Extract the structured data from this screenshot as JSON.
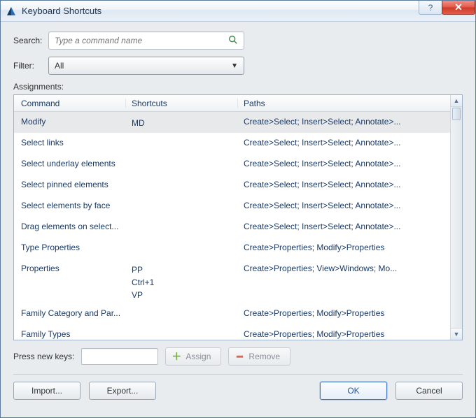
{
  "window": {
    "title": "Keyboard Shortcuts"
  },
  "labels": {
    "search": "Search:",
    "filter": "Filter:",
    "assignments": "Assignments:",
    "press_new_keys": "Press new keys:"
  },
  "search": {
    "placeholder": "Type a command name"
  },
  "filter": {
    "value": "All"
  },
  "columns": {
    "command": "Command",
    "shortcuts": "Shortcuts",
    "paths": "Paths"
  },
  "rows": [
    {
      "command": "Modify",
      "shortcuts": [
        "MD"
      ],
      "path": "Create>Select; Insert>Select; Annotate>...",
      "selected": true
    },
    {
      "command": "Select links",
      "shortcuts": [],
      "path": "Create>Select; Insert>Select; Annotate>..."
    },
    {
      "command": "Select underlay elements",
      "shortcuts": [],
      "path": "Create>Select; Insert>Select; Annotate>..."
    },
    {
      "command": "Select pinned elements",
      "shortcuts": [],
      "path": "Create>Select; Insert>Select; Annotate>..."
    },
    {
      "command": "Select elements by face",
      "shortcuts": [],
      "path": "Create>Select; Insert>Select; Annotate>..."
    },
    {
      "command": "Drag elements on select...",
      "shortcuts": [],
      "path": "Create>Select; Insert>Select; Annotate>..."
    },
    {
      "command": "Type Properties",
      "shortcuts": [],
      "path": "Create>Properties; Modify>Properties"
    },
    {
      "command": "Properties",
      "shortcuts": [
        "PP",
        "Ctrl+1",
        "VP"
      ],
      "path": "Create>Properties; View>Windows; Mo..."
    },
    {
      "command": "Family Category and Par...",
      "shortcuts": [],
      "path": "Create>Properties; Modify>Properties"
    },
    {
      "command": "Family Types",
      "shortcuts": [],
      "path": "Create>Properties; Modify>Properties"
    }
  ],
  "buttons": {
    "assign": "Assign",
    "remove": "Remove",
    "import": "Import...",
    "export": "Export...",
    "ok": "OK",
    "cancel": "Cancel"
  },
  "colors": {
    "link_text": "#1a3a66",
    "titlebar_close": "#cf3b28",
    "plus_icon": "#6fae3a",
    "minus_icon": "#d06a5a"
  }
}
